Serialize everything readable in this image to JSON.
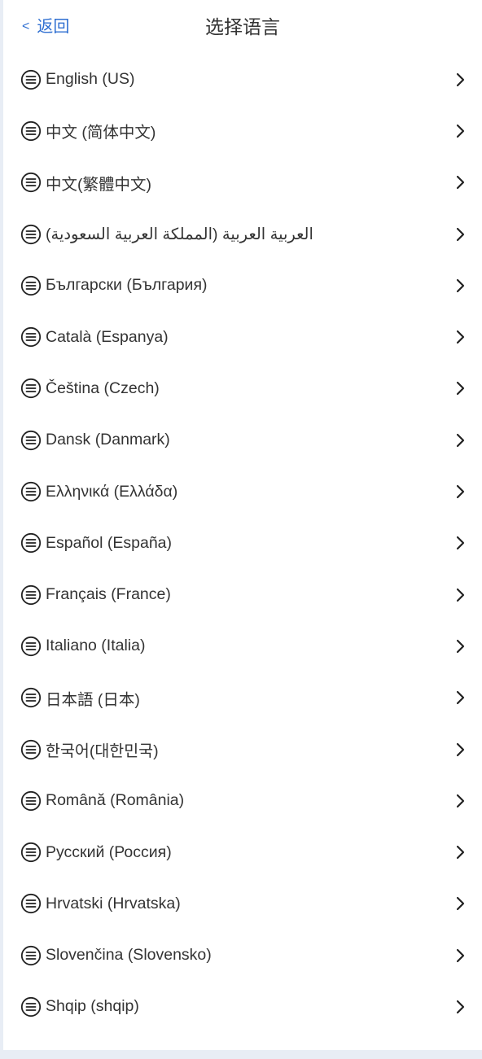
{
  "header": {
    "back_chevron": "<",
    "back_label": "返回",
    "title": "选择语言"
  },
  "icons": {
    "item_icon": "menu-lines-circle-icon",
    "item_chevron": "chevron-right-icon"
  },
  "colors": {
    "accent": "#2f6fd1",
    "text": "#333333",
    "background": "#e8edf5"
  },
  "languages": [
    {
      "label": "English (US)"
    },
    {
      "label": "中文 (简体中文)"
    },
    {
      "label": "中文(繁體中文)"
    },
    {
      "label": "العربية العربية (المملكة العربية السعودية)"
    },
    {
      "label": "Български (България)"
    },
    {
      "label": "Català (Espanya)"
    },
    {
      "label": "Čeština (Czech)"
    },
    {
      "label": "Dansk (Danmark)"
    },
    {
      "label": "Ελληνικά (Ελλάδα)"
    },
    {
      "label": "Español (España)"
    },
    {
      "label": "Français (France)"
    },
    {
      "label": "Italiano (Italia)"
    },
    {
      "label": "日本語 (日本)"
    },
    {
      "label": "한국어(대한민국)"
    },
    {
      "label": "Română (România)"
    },
    {
      "label": "Русский (Россия)"
    },
    {
      "label": "Hrvatski (Hrvatska)"
    },
    {
      "label": "Slovenčina (Slovensko)"
    },
    {
      "label": "Shqip (shqip)"
    }
  ]
}
